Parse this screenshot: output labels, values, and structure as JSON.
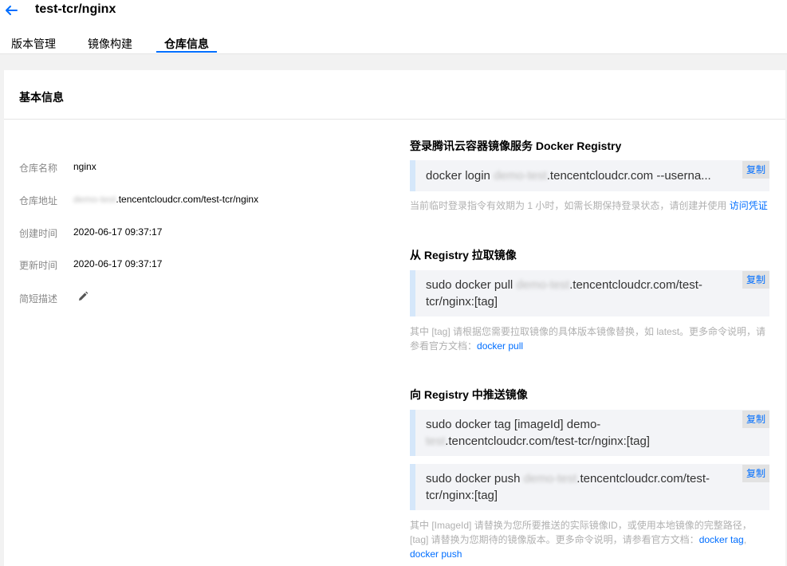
{
  "header": {
    "title": "test-tcr/nginx",
    "tabs": [
      {
        "label": "版本管理"
      },
      {
        "label": "镜像构建"
      },
      {
        "label": "仓库信息"
      }
    ]
  },
  "basic": {
    "title": "基本信息",
    "name_label": "仓库名称",
    "name_value": "nginx",
    "address_label": "仓库地址",
    "address_masked": "demo-test",
    "address_rest": ".tencentcloudcr.com/test-tcr/nginx",
    "created_label": "创建时间",
    "created_value": "2020-06-17 09:37:17",
    "updated_label": "更新时间",
    "updated_value": "2020-06-17 09:37:17",
    "desc_label": "简短描述"
  },
  "login": {
    "title": "登录腾讯云容器镜像服务 Docker Registry",
    "cmd_a": "docker login ",
    "cmd_masked": "demo-test",
    "cmd_b": ".tencentcloudcr.com --userna...",
    "copy": "复制",
    "note": "当前临时登录指令有效期为 1 小时，如需长期保持登录状态，请创建并使用 ",
    "note_link": "访问凭证"
  },
  "pull": {
    "title": "从 Registry 拉取镜像",
    "cmd_a": "sudo docker pull ",
    "cmd_masked": "demo-test",
    "cmd_b": ".tencentcloudcr.com/test-",
    "cmd_c": "tcr/nginx:[tag]",
    "copy": "复制",
    "note": "其中 [tag] 请根据您需要拉取镜像的具体版本镜像替换，如 latest。更多命令说明，请参看官方文档：",
    "note_link": "docker pull"
  },
  "push": {
    "title": "向 Registry 中推送镜像",
    "tag_cmd_a": "sudo docker tag [imageId] demo-",
    "tag_cmd_masked": "test",
    "tag_cmd_b": ".tencentcloudcr.com/test-tcr/nginx:[tag]",
    "push_cmd_a": "sudo docker push ",
    "push_cmd_masked": "demo-test",
    "push_cmd_b": ".tencentcloudcr.com/test-",
    "push_cmd_c": "tcr/nginx:[tag]",
    "copy": "复制",
    "note": "其中 [ImageId] 请替换为您所要推送的实际镜像ID，或使用本地镜像的完整路径，[tag] 请替换为您期待的镜像版本。更多命令说明，请参看官方文档：",
    "note_link_1": "docker tag",
    "note_sep": ",",
    "note_link_2": "docker push"
  }
}
